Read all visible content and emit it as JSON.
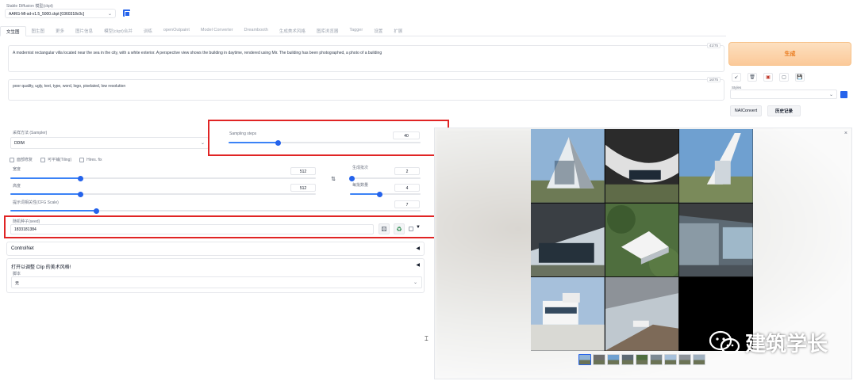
{
  "header": {
    "model_label": "Stable Diffusion 模型(ckpt)",
    "model_value": "AARG-Ml-sd-v1.5_5000.ckpt [0360318c0c]"
  },
  "tabs": [
    {
      "label": "文生图",
      "active": true
    },
    {
      "label": "图生图"
    },
    {
      "label": "更多"
    },
    {
      "label": "图片信息"
    },
    {
      "label": "模型(ckpt)合并"
    },
    {
      "label": "训练"
    },
    {
      "label": "openOutpaint"
    },
    {
      "label": "Model Converter"
    },
    {
      "label": "Dreambooth"
    },
    {
      "label": "生成美术风格"
    },
    {
      "label": "图库浏览器"
    },
    {
      "label": "Tagger"
    },
    {
      "label": "设置"
    },
    {
      "label": "扩展"
    }
  ],
  "prompt": {
    "text": "A modernist rectangular villa located near the sea in the city, with a white exterior. A perspective view shows the building in daytime, rendered using Mir. The building has been photographed,   a photo of a building",
    "counter": "41/75"
  },
  "negative_prompt": {
    "text": "poor quality, ugly, text, type, word, logo, pixelated, low resolution",
    "counter": "16/75"
  },
  "generate_button": "生成",
  "action_icons": [
    "↙",
    "🗑",
    "▣",
    "▢",
    "💾"
  ],
  "styles": {
    "label": "Styles"
  },
  "nai_button": "NAIConvert",
  "history_button": "历史记录",
  "sampler": {
    "label": "采样方法 (Sampler)",
    "value": "DDIM"
  },
  "sampling_steps": {
    "label": "Sampling steps",
    "value": "40",
    "fraction": 0.26
  },
  "checkboxes": [
    {
      "label": "面部修复"
    },
    {
      "label": "可平铺(Tiling)"
    },
    {
      "label": "Hires. fix"
    }
  ],
  "width": {
    "label": "宽度",
    "value": "512",
    "fraction": 0.23
  },
  "height": {
    "label": "高度",
    "value": "512",
    "fraction": 0.23
  },
  "swap_icon": "⇅",
  "batch_count": {
    "label": "生成批次",
    "value": "2",
    "fraction": 0.03
  },
  "batch_size": {
    "label": "每批数量",
    "value": "4",
    "fraction": 0.42
  },
  "cfg": {
    "label": "提示词相关性(CFG Scale)",
    "value": "7",
    "fraction": 0.21
  },
  "seed": {
    "label": "随机种子(seed)",
    "value": "1833181384",
    "dice_icon": "⚄",
    "recycle_icon": "♻",
    "extra_icon": "▼"
  },
  "controlnet": {
    "title": "ControlNet",
    "arrow": "◀"
  },
  "clip": {
    "title": "打开以调整 Clip 的美术风格!",
    "arrow": "◀",
    "script_label": "脚本",
    "script_value": "无"
  },
  "gallery": {
    "close": "×",
    "thumb_count": 9
  },
  "watermark": {
    "text": "建筑学长"
  },
  "colors": {
    "accent": "#2563eb",
    "generate_text": "#ea7a1c",
    "annotation_red": "#e02424"
  }
}
